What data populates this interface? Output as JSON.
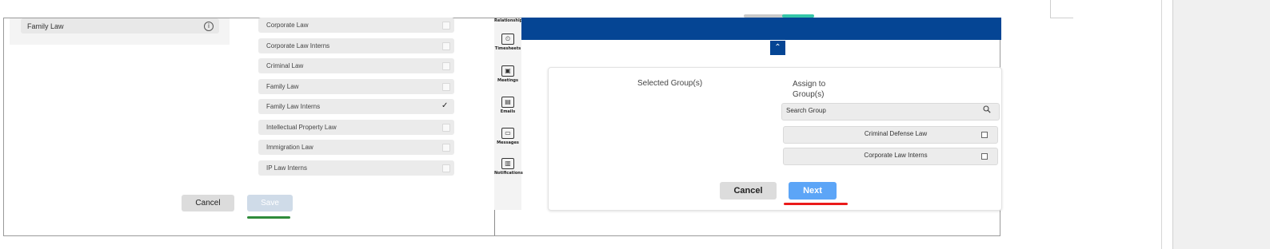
{
  "left_panel": {
    "family_law_label": "Family Law",
    "groups": [
      {
        "label": "Corporate Law",
        "checked": false
      },
      {
        "label": "Corporate Law Interns",
        "checked": false
      },
      {
        "label": "Criminal Law",
        "checked": false
      },
      {
        "label": "Family Law",
        "checked": false
      },
      {
        "label": "Family Law Interns",
        "checked": true
      },
      {
        "label": "Intellectual Property Law",
        "checked": false
      },
      {
        "label": "Immigration Law",
        "checked": false
      },
      {
        "label": "IP Law Interns",
        "checked": false
      }
    ],
    "cancel_label": "Cancel",
    "save_label": "Save"
  },
  "sidebar": {
    "items": [
      {
        "label": "Relationships",
        "icon": "relationships-icon"
      },
      {
        "label": "Timesheets",
        "icon": "timesheets-icon"
      },
      {
        "label": "Meetings",
        "icon": "meetings-icon"
      },
      {
        "label": "Emails",
        "icon": "emails-icon"
      },
      {
        "label": "Messages",
        "icon": "messages-icon"
      },
      {
        "label": "Notifications",
        "icon": "notifications-icon"
      }
    ]
  },
  "right_panel": {
    "selected_groups_title": "Selected Group(s)",
    "assign_title": "Assign to Group(s)",
    "search_placeholder": "Search Group",
    "options": [
      {
        "label": "Criminal Defense Law",
        "checked": false
      },
      {
        "label": "Corporate Law Interns",
        "checked": false
      }
    ],
    "cancel_label": "Cancel",
    "next_label": "Next"
  },
  "colors": {
    "brand_blue": "#054594",
    "next_button": "#5ca5f7",
    "underline_red": "#ea1a1a",
    "underline_green": "#2e8b3a"
  }
}
